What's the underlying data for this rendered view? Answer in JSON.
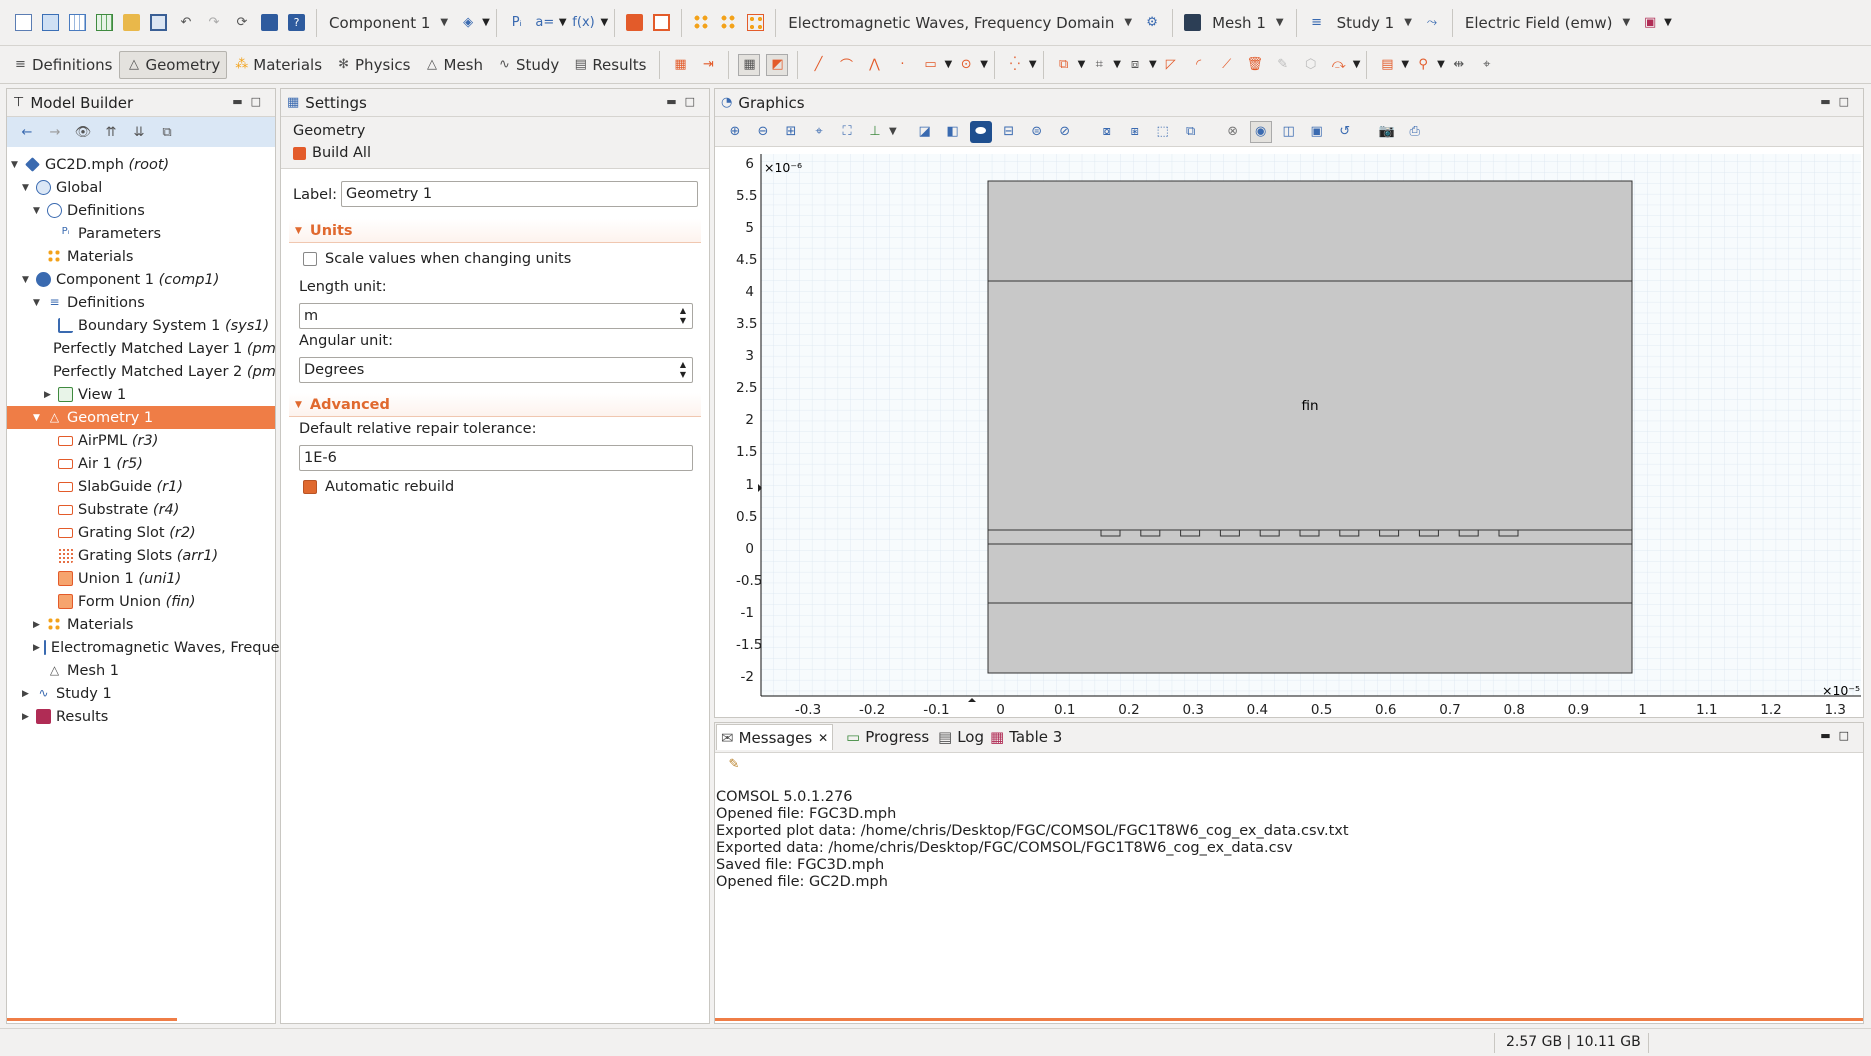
{
  "toolbar": {
    "component": "Component 1",
    "physics": "Electromagnetic Waves, Frequency Domain",
    "mesh": "Mesh 1",
    "study": "Study 1",
    "plot": "Electric Field (emw)"
  },
  "ribbon": {
    "tabs": [
      {
        "label": "Definitions"
      },
      {
        "label": "Geometry"
      },
      {
        "label": "Materials"
      },
      {
        "label": "Physics"
      },
      {
        "label": "Mesh"
      },
      {
        "label": "Study"
      },
      {
        "label": "Results"
      }
    ]
  },
  "model_builder": {
    "title": "Model Builder",
    "tree": [
      {
        "label": "GC2D.mph",
        "tag": "(root)"
      },
      {
        "label": "Global",
        "tag": ""
      },
      {
        "label": "Definitions",
        "tag": ""
      },
      {
        "label": "Parameters",
        "tag": ""
      },
      {
        "label": "Materials",
        "tag": ""
      },
      {
        "label": "Component 1",
        "tag": "(comp1)"
      },
      {
        "label": "Definitions",
        "tag": ""
      },
      {
        "label": "Boundary System 1",
        "tag": "(sys1)"
      },
      {
        "label": "Perfectly Matched Layer 1",
        "tag": "(pm"
      },
      {
        "label": "Perfectly Matched Layer 2",
        "tag": "(pm"
      },
      {
        "label": "View 1",
        "tag": ""
      },
      {
        "label": "Geometry 1",
        "tag": ""
      },
      {
        "label": "AirPML",
        "tag": "(r3)"
      },
      {
        "label": "Air 1",
        "tag": "(r5)"
      },
      {
        "label": "SlabGuide",
        "tag": "(r1)"
      },
      {
        "label": "Substrate",
        "tag": "(r4)"
      },
      {
        "label": "Grating Slot",
        "tag": "(r2)"
      },
      {
        "label": "Grating Slots",
        "tag": "(arr1)"
      },
      {
        "label": "Union 1",
        "tag": "(uni1)"
      },
      {
        "label": "Form Union",
        "tag": "(fin)"
      },
      {
        "label": "Materials",
        "tag": ""
      },
      {
        "label": "Electromagnetic Waves, Freque",
        "tag": ""
      },
      {
        "label": "Mesh 1",
        "tag": ""
      },
      {
        "label": "Study 1",
        "tag": ""
      },
      {
        "label": "Results",
        "tag": ""
      }
    ]
  },
  "settings": {
    "title": "Settings",
    "subtitle": "Geometry",
    "build_all": "Build All",
    "label_caption": "Label:",
    "label_value": "Geometry 1",
    "units_section": "Units",
    "scale_values": "Scale values when changing units",
    "length_unit_caption": "Length unit:",
    "length_unit": "m",
    "angular_unit_caption": "Angular unit:",
    "angular_unit": "Degrees",
    "advanced_section": "Advanced",
    "tolerance_caption": "Default relative repair tolerance:",
    "tolerance_value": "1E-6",
    "auto_rebuild": "Automatic rebuild"
  },
  "graphics": {
    "title": "Graphics",
    "y_multiplier": "×10⁻⁶",
    "x_multiplier": "×10⁻⁵",
    "domain_label": "fin",
    "y_ticks": [
      "6",
      "5.5",
      "5",
      "4.5",
      "4",
      "3.5",
      "3",
      "2.5",
      "2",
      "1.5",
      "1",
      "0.5",
      "0",
      "-0.5",
      "-1",
      "-1.5",
      "-2"
    ],
    "x_ticks": [
      "-0.3",
      "-0.2",
      "-0.1",
      "0",
      "0.1",
      "0.2",
      "0.3",
      "0.4",
      "0.5",
      "0.6",
      "0.7",
      "0.8",
      "0.9",
      "1",
      "1.1",
      "1.2",
      "1.3"
    ]
  },
  "messages": {
    "tabs": [
      {
        "label": "Messages"
      },
      {
        "label": "Progress"
      },
      {
        "label": "Log"
      },
      {
        "label": "Table 3"
      }
    ],
    "lines": [
      "COMSOL 5.0.1.276",
      "Opened file: FGC3D.mph",
      "Exported plot data: /home/chris/Desktop/FGC/COMSOL/FGC1T8W6_cog_ex_data.csv.txt",
      "Exported data: /home/chris/Desktop/FGC/COMSOL/FGC1T8W6_cog_ex_data.csv",
      "Saved file: FGC3D.mph",
      "Opened file: GC2D.mph"
    ]
  },
  "status": {
    "memory": "2.57 GB | 10.11 GB"
  }
}
